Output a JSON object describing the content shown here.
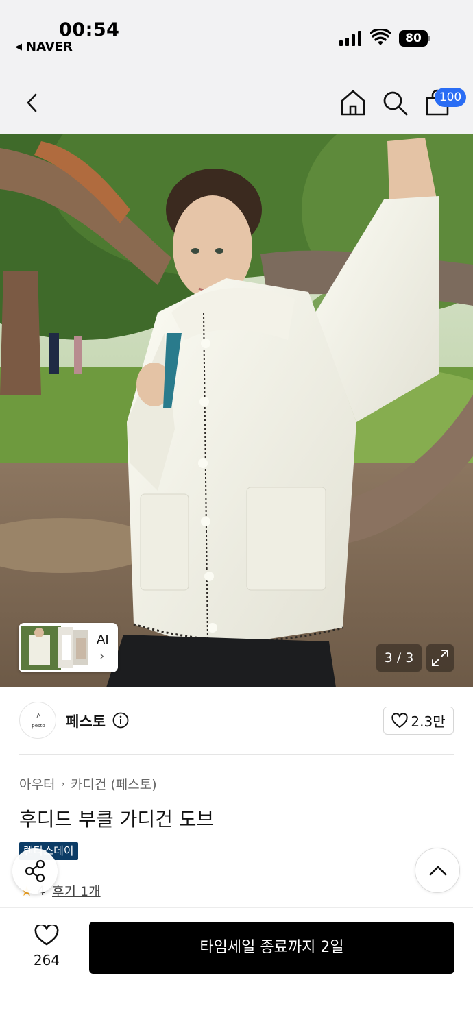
{
  "status_bar": {
    "time": "00:54",
    "back_app": "NAVER",
    "battery": "80"
  },
  "nav": {
    "cart_badge": "100",
    "icons": [
      "back-chevron-icon",
      "home-icon",
      "search-icon",
      "shopping-bag-icon"
    ]
  },
  "image": {
    "counter": "3 / 3",
    "ai_label": "AI",
    "ai_chevron": "›"
  },
  "brand": {
    "logo_text": "pesto",
    "name": "페스토",
    "likes": "2.3만"
  },
  "product": {
    "breadcrumb": [
      "아우터",
      "카디건 (페스토)"
    ],
    "breadcrumb_sep": "›",
    "title": "후디드 부클 가디건 도브",
    "event_badge": "렌타스데이",
    "rating": "4",
    "review_link": "후기 1개"
  },
  "bottom_bar": {
    "wish_count": "264",
    "cta": "타임세일 종료까지 2일"
  },
  "colors": {
    "accent": "#2a6df4",
    "badge_navy": "#0c3c66",
    "cta_bg": "#000000",
    "star": "#f5a623"
  }
}
